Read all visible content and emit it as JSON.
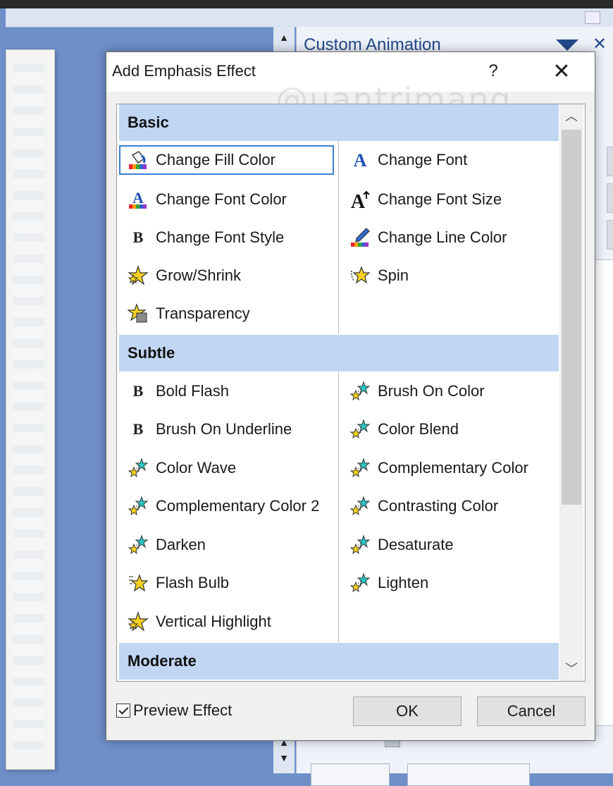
{
  "background": {
    "task_pane_title": "Custom Animation"
  },
  "dialog": {
    "title": "Add Emphasis Effect",
    "help_label": "?",
    "close_label": "✕",
    "watermark": "@uantrimang"
  },
  "categories": {
    "basic": "Basic",
    "subtle": "Subtle",
    "moderate": "Moderate"
  },
  "basic": {
    "left": [
      "Change Fill Color",
      "Change Font Color",
      "Change Font Style",
      "Grow/Shrink",
      "Transparency"
    ],
    "right": [
      "Change Font",
      "Change Font Size",
      "Change Line Color",
      "Spin"
    ]
  },
  "subtle": {
    "left": [
      "Bold Flash",
      "Brush On Underline",
      "Color Wave",
      "Complementary Color 2",
      "Darken",
      "Flash Bulb",
      "Vertical Highlight"
    ],
    "right": [
      "Brush On Color",
      "Color Blend",
      "Complementary Color",
      "Contrasting Color",
      "Desaturate",
      "Lighten"
    ]
  },
  "footer": {
    "preview_label": "Preview Effect",
    "preview_checked": true,
    "ok_label": "OK",
    "cancel_label": "Cancel"
  },
  "colors": {
    "category_header": "#c1d6f3",
    "selection_outline": "#3d7fd6",
    "task_pane_title": "#244a8a"
  }
}
